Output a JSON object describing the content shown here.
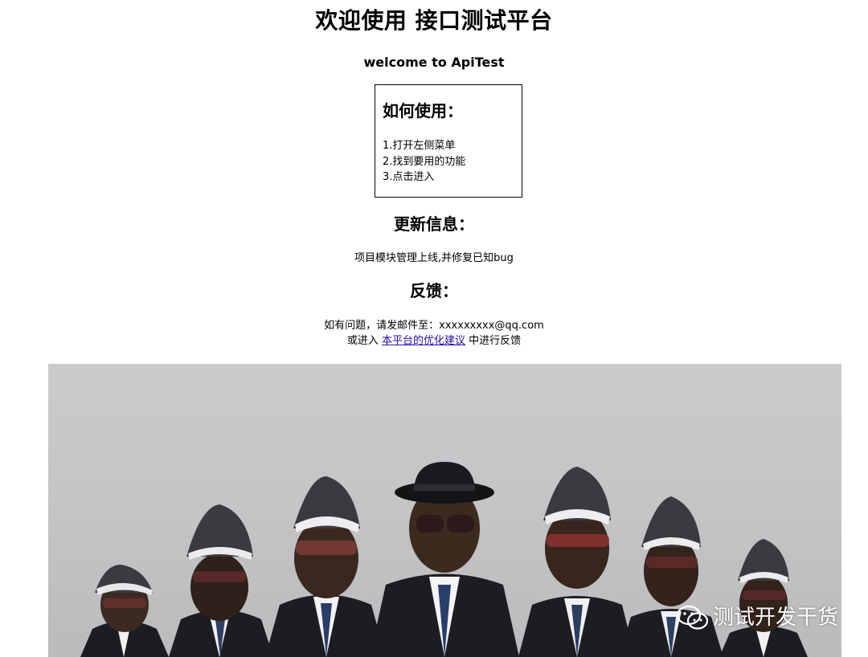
{
  "header": {
    "title": "欢迎使用 接口测试平台",
    "subtitle": "welcome to ApiTest"
  },
  "howto": {
    "title": "如何使用：",
    "steps": [
      "1.打开左侧菜单",
      "2.找到要用的功能",
      "3.点击进入"
    ]
  },
  "update": {
    "title": "更新信息：",
    "text": "项目模块管理上线,并修复已知bug"
  },
  "feedback": {
    "title": "反馈：",
    "line1": "如有问题，请发邮件至：xxxxxxxxx@qq.com",
    "line2_prefix": "或进入 ",
    "link_label": "本平台的优化建议",
    "line2_suffix": " 中进行反馈"
  },
  "banner": {
    "watermark": "测试开发干货",
    "icon": "wechat-icon"
  },
  "colors": {
    "link": "#2a0fa8",
    "banner_bg": "#c3c5c7",
    "suit": "#1c1d22"
  }
}
